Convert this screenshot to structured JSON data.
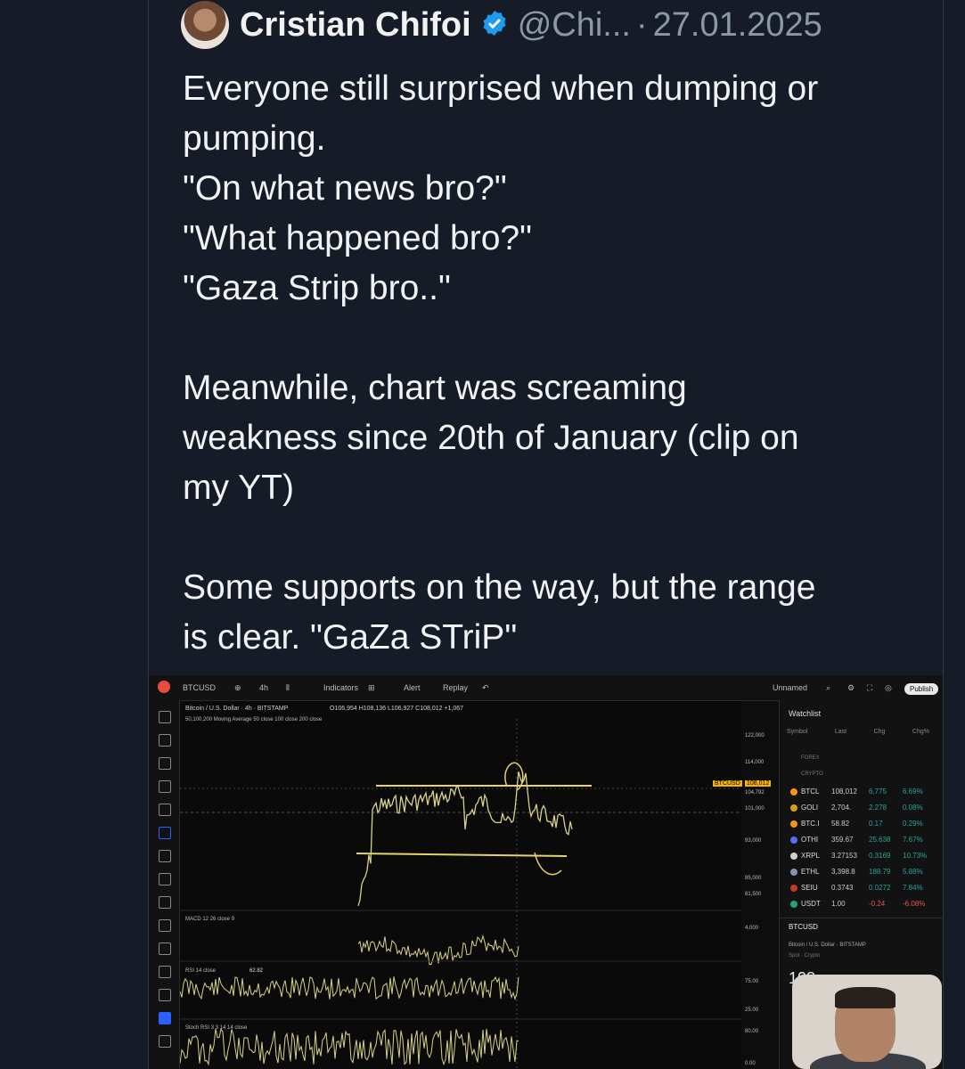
{
  "tweet": {
    "author_name": "Cristian Chifoi",
    "handle": "@Chi...",
    "separator": "·",
    "date": "27.01.2025",
    "paragraphs": [
      "Everyone still surprised when dumping or\npumping.\n\"On what news bro?\"\n\"What happened bro?\"\n\"Gaza Strip bro..\"",
      "Meanwhile, chart was screaming\nweakness since 20th of January (clip on\nmy YT)",
      "Some supports on the way, but the range\nis clear. \"GaZa STriP\""
    ]
  },
  "chart": {
    "toolbar": {
      "symbol": "BTCUSD",
      "interval": "4h",
      "indicators": "Indicators",
      "alert": "Alert",
      "replay": "Replay",
      "layout_name": "Unnamed",
      "publish": "Publish"
    },
    "legend": {
      "title": "Bitcoin / U.S. Dollar · 4h · BITSTAMP",
      "ohlc": "O106,954 H108,136 L106,927 C108,012 +1,067",
      "ma": "50,100,200 Moving Average 50 close 100 close 200 close",
      "macd": "MACD 12 26 close 9",
      "rsi": "RSI 14 close",
      "rsi_value": "62.82",
      "stoch": "Stoch RSI 3 3 14 14 close"
    },
    "price_axis": [
      "122,000",
      "114,000",
      "104,792",
      "101,000",
      "93,000",
      "85,000",
      "81,500"
    ],
    "current_price_label": "BTCUSD",
    "current_price": "108,012",
    "lower_axis": [
      "4,000",
      "75.00",
      "25.00",
      "80.00",
      "0.00"
    ],
    "watchlist": {
      "title": "Watchlist",
      "columns": [
        "Symbol",
        "Last",
        "Chg",
        "Chg%"
      ],
      "sections": [
        "FOREX",
        "CRYPTO"
      ],
      "rows": [
        {
          "sym": "BTCL",
          "last": "108,012",
          "chg": "6,775",
          "pct": "6.69%",
          "color": "#f7931a"
        },
        {
          "sym": "GOLI",
          "last": "2,704.",
          "chg": "2.278",
          "pct": "0.08%",
          "color": "#d4a017"
        },
        {
          "sym": "BTC.I",
          "last": "58.82",
          "chg": "0.17",
          "pct": "0.29%",
          "color": "#f7931a"
        },
        {
          "sym": "OTHI",
          "last": "359.67",
          "chg": "25.638",
          "pct": "7.67%",
          "color": "#5b6cf0"
        },
        {
          "sym": "XRPL",
          "last": "3.27153",
          "chg": "0.3169",
          "pct": "10.73%",
          "color": "#cfcfcf"
        },
        {
          "sym": "ETHL",
          "last": "3,398.8",
          "chg": "188.79",
          "pct": "5.88%",
          "color": "#8a92b2"
        },
        {
          "sym": "SEIU",
          "last": "0.3743",
          "chg": "0.0272",
          "pct": "7.84%",
          "color": "#c0392b"
        },
        {
          "sym": "USDT",
          "last": "1.00",
          "chg": "-0.24",
          "pct": "-6.08%",
          "color": "#26a17b"
        }
      ],
      "detail_symbol": "BTCUSD",
      "detail_name": "Bitcoin / U.S. Dollar · BITSTAMP",
      "detail_sub": "Spot · Crypto",
      "detail_price": "108"
    }
  },
  "colors": {
    "background": "#151c27",
    "text": "#e7e9ea",
    "muted": "#8b98a5",
    "verified": "#1d9bf0",
    "chart_line": "#d8d28a",
    "annotation": "#e8d36a"
  }
}
